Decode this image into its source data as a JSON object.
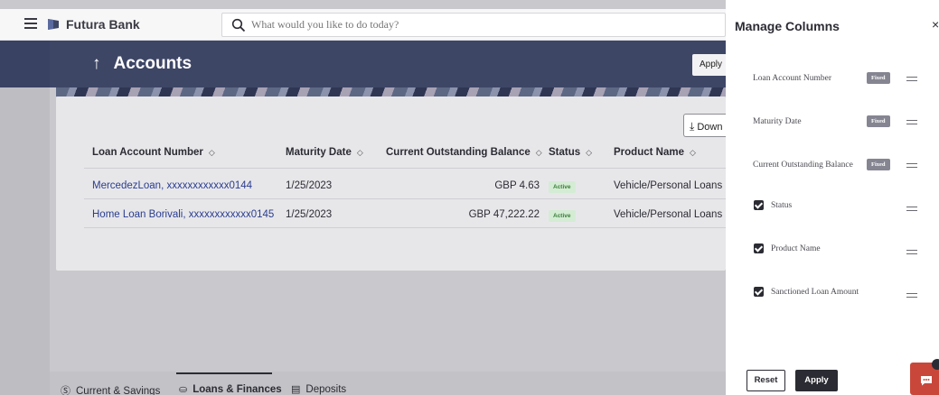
{
  "header": {
    "brand": "Futura Bank",
    "search_placeholder": "What would you like to do today?"
  },
  "page": {
    "back_arrow": "↑",
    "title": "Accounts",
    "apply_partial": "Apply",
    "download_label": "Down"
  },
  "table": {
    "columns": [
      "Loan Account Number",
      "Maturity Date",
      "Current Outstanding Balance",
      "Status",
      "Product Name"
    ],
    "rows": [
      {
        "account": "MercedezLoan, xxxxxxxxxxxx0144",
        "maturity": "1/25/2023",
        "balance": "GBP 4.63",
        "status": "Active",
        "product": "Vehicle/Personal Loans"
      },
      {
        "account": "Home Loan Borivali, xxxxxxxxxxxx0145",
        "maturity": "1/25/2023",
        "balance": "GBP 47,222.22",
        "status": "Active",
        "product": "Vehicle/Personal Loans"
      }
    ]
  },
  "tabs": [
    {
      "label": "Current & Savings",
      "icon": "dollar-circle-icon"
    },
    {
      "label": "Loans & Finances",
      "icon": "loan-icon"
    },
    {
      "label": "Deposits",
      "icon": "deposit-icon"
    }
  ],
  "manage_columns": {
    "title": "Manage Columns",
    "close": "×",
    "fixed_label": "Fixed",
    "items": [
      {
        "label": "Loan Account Number",
        "fixed": true
      },
      {
        "label": "Maturity Date",
        "fixed": true
      },
      {
        "label": "Current Outstanding Balance",
        "fixed": true
      },
      {
        "label": "Status",
        "fixed": false,
        "checked": true
      },
      {
        "label": "Product Name",
        "fixed": false,
        "checked": true
      },
      {
        "label": "Sanctioned Loan Amount",
        "fixed": false,
        "checked": true
      }
    ],
    "reset_label": "Reset",
    "apply_label": "Apply"
  },
  "colors": {
    "header_bg": "#3e4666",
    "accent_dark": "#2b2b33",
    "chat": "#c9473a",
    "active_badge": "#d4ecd4"
  }
}
